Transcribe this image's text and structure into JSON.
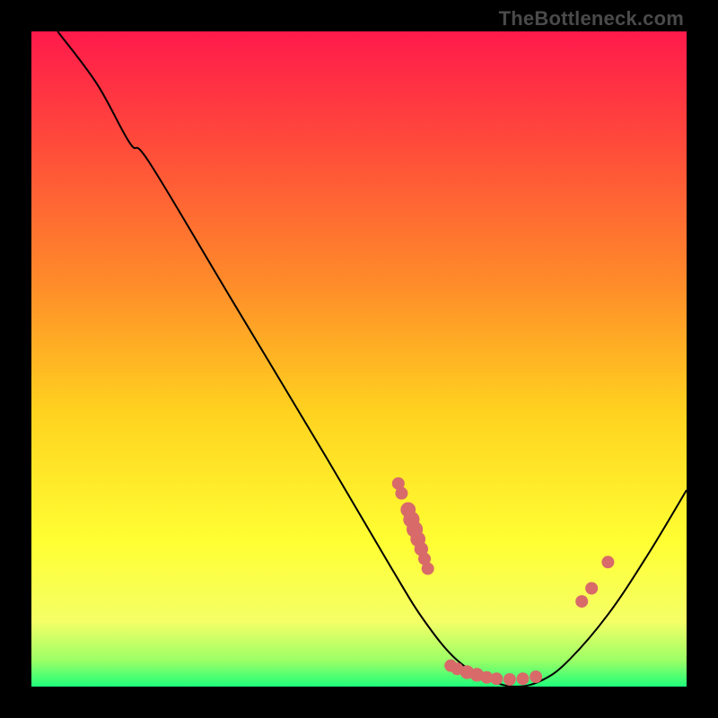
{
  "watermark": "TheBottleneck.com",
  "chart_data": {
    "type": "line",
    "title": "",
    "xlabel": "",
    "ylabel": "",
    "xlim": [
      0,
      100
    ],
    "ylim": [
      0,
      100
    ],
    "gradient_stops": [
      {
        "offset": 0,
        "color": "#ff1a4b"
      },
      {
        "offset": 18,
        "color": "#ff4d3a"
      },
      {
        "offset": 38,
        "color": "#ff8a2a"
      },
      {
        "offset": 58,
        "color": "#ffd21f"
      },
      {
        "offset": 78,
        "color": "#ffff33"
      },
      {
        "offset": 90,
        "color": "#f5ff66"
      },
      {
        "offset": 96,
        "color": "#9cff66"
      },
      {
        "offset": 100,
        "color": "#1fff7a"
      }
    ],
    "curve": [
      {
        "x": 4,
        "y": 100
      },
      {
        "x": 10,
        "y": 92
      },
      {
        "x": 15,
        "y": 83
      },
      {
        "x": 18,
        "y": 80
      },
      {
        "x": 30,
        "y": 60
      },
      {
        "x": 45,
        "y": 35
      },
      {
        "x": 55,
        "y": 18
      },
      {
        "x": 60,
        "y": 10
      },
      {
        "x": 65,
        "y": 4
      },
      {
        "x": 70,
        "y": 1
      },
      {
        "x": 74,
        "y": 0
      },
      {
        "x": 78,
        "y": 1
      },
      {
        "x": 82,
        "y": 4
      },
      {
        "x": 88,
        "y": 11
      },
      {
        "x": 94,
        "y": 20
      },
      {
        "x": 100,
        "y": 30
      }
    ],
    "dots": [
      {
        "x": 56,
        "y": 31,
        "r": 1.0
      },
      {
        "x": 56.5,
        "y": 29.5,
        "r": 1.0
      },
      {
        "x": 57.5,
        "y": 27,
        "r": 1.2
      },
      {
        "x": 58,
        "y": 25.5,
        "r": 1.3
      },
      {
        "x": 58.5,
        "y": 24,
        "r": 1.3
      },
      {
        "x": 59,
        "y": 22.5,
        "r": 1.2
      },
      {
        "x": 59.5,
        "y": 21,
        "r": 1.1
      },
      {
        "x": 60,
        "y": 19.5,
        "r": 1.0
      },
      {
        "x": 60.5,
        "y": 18,
        "r": 1.0
      },
      {
        "x": 64,
        "y": 3.2,
        "r": 1.0
      },
      {
        "x": 65,
        "y": 2.7,
        "r": 1.0
      },
      {
        "x": 66.5,
        "y": 2.2,
        "r": 1.1
      },
      {
        "x": 68,
        "y": 1.8,
        "r": 1.1
      },
      {
        "x": 69.5,
        "y": 1.4,
        "r": 1.0
      },
      {
        "x": 71,
        "y": 1.2,
        "r": 1.0
      },
      {
        "x": 73,
        "y": 1.1,
        "r": 1.0
      },
      {
        "x": 75,
        "y": 1.2,
        "r": 1.0
      },
      {
        "x": 77,
        "y": 1.5,
        "r": 1.0
      },
      {
        "x": 84,
        "y": 13,
        "r": 1.0
      },
      {
        "x": 85.5,
        "y": 15,
        "r": 1.0
      },
      {
        "x": 88,
        "y": 19,
        "r": 1.0
      }
    ],
    "dot_color": "#d86a6a",
    "curve_color": "#000000"
  }
}
